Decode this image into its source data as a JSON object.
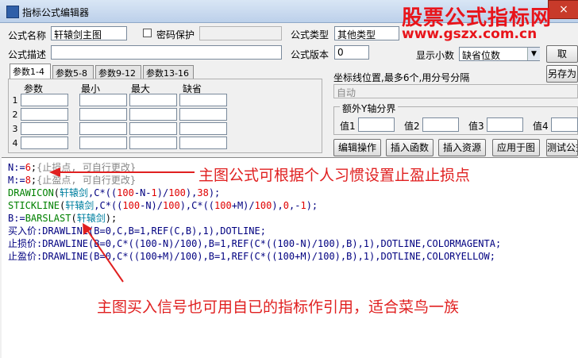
{
  "window": {
    "title": "指标公式编辑器",
    "close_label": "×"
  },
  "watermark": {
    "line1": "股票公式指标网",
    "line2": "www.gszx.com.cn"
  },
  "form": {
    "name_label": "公式名称",
    "name_value": "轩辕剑主图",
    "password_label": "密码保护",
    "type_label": "公式类型",
    "type_value": "其他类型",
    "desc_label": "公式描述",
    "desc_value": "",
    "version_label": "公式版本",
    "version_value": "0",
    "decimal_label": "显示小数",
    "decimal_value": "缺省位数",
    "take_label": "取",
    "saveas_label": "另存为"
  },
  "params": {
    "tabs": [
      "参数1-4",
      "参数5-8",
      "参数9-12",
      "参数13-16"
    ],
    "headers": [
      "参数",
      "最小",
      "最大",
      "缺省"
    ],
    "rows": [
      "1",
      "2",
      "3",
      "4"
    ]
  },
  "axis": {
    "coord_label": "坐标线位置,最多6个,用分号分隔",
    "coord_value": "自动",
    "extra_label": "额外Y轴分界",
    "values": [
      "值1",
      "值2",
      "值3",
      "值4"
    ]
  },
  "buttons": {
    "edit": "编辑操作",
    "insert_func": "插入函数",
    "insert_res": "插入资源",
    "apply": "应用于图",
    "test": "测试公式"
  },
  "code": {
    "line1": {
      "a": "N:=",
      "b": "6",
      "c": ";",
      "d": "{止损点, 可自行更改}"
    },
    "line2": {
      "a": "M:=",
      "b": "8",
      "c": ";",
      "d": "{止盈点, 可自行更改}"
    },
    "line3": {
      "fn": "DRAWICON",
      "a": "(",
      "s": "轩辕剑",
      "b": ",C*((",
      "n1": "100",
      "c": "-N-",
      "n2": "1",
      "d": ")/",
      "n3": "100",
      "e": "),",
      "n4": "38",
      "f": ");"
    },
    "line4": {
      "fn": "STICKLINE",
      "a": "(",
      "s": "轩辕剑",
      "b": ",C*((",
      "n1": "100",
      "c": "-N)/",
      "n2": "100",
      "d": "),C*((",
      "n3": "100",
      "e": "+M)/",
      "n4": "100",
      "f": "),",
      "n5": "0",
      "g": ",-",
      "n6": "1",
      "h": ");"
    },
    "line5": {
      "a": "B:=",
      "fn": "BARSLAST",
      "b": "(",
      "s": "轩辕剑",
      "c": ");"
    },
    "line6": "买入价:DRAWLINE(B=0,C,B=1,REF(C,B),1),DOTLINE;",
    "line7": "止损价:DRAWLINE(B=0,C*((100-N)/100),B=1,REF(C*((100-N)/100),B),1),DOTLINE,COLORMAGENTA;",
    "line8": "止盈价:DRAWLINE(B=0,C*((100+M)/100),B=1,REF(C*((100+M)/100),B),1),DOTLINE,COLORYELLOW;"
  },
  "annotations": {
    "top": "主图公式可根据个人习惯设置止盈止损点",
    "bottom": "主图买入信号也可用自已的指标作引用，适合菜鸟一族"
  },
  "colors": {
    "annotation": "#e02020",
    "watermark": "#e8141a"
  }
}
